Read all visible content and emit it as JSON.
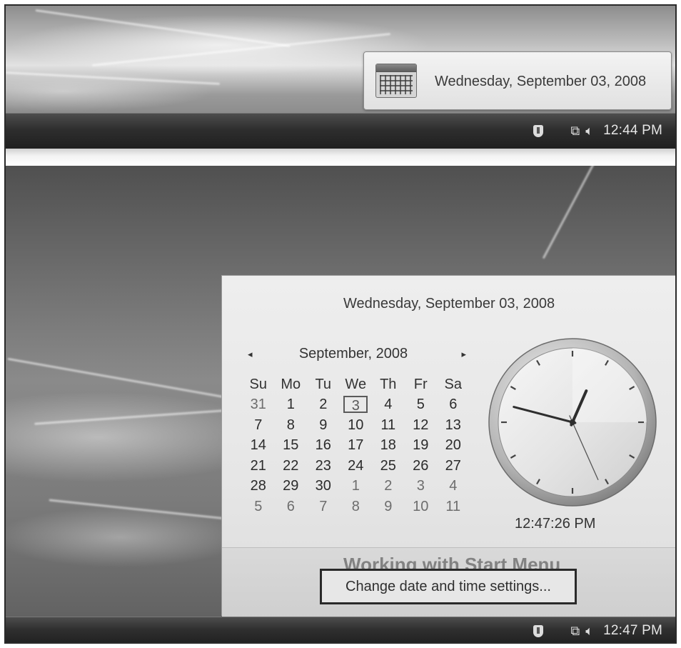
{
  "tooltip": {
    "icon": "calendar-icon",
    "date_text": "Wednesday, September 03, 2008"
  },
  "taskbar_top": {
    "tray_icons": [
      "shield-icon",
      "network-icon",
      "volume-icon"
    ],
    "time": "12:44 PM"
  },
  "flyout": {
    "long_date": "Wednesday, September 03, 2008",
    "month_label": "September, 2008",
    "nav_prev": "◂",
    "nav_next": "▸",
    "weekdays": [
      "Su",
      "Mo",
      "Tu",
      "We",
      "Th",
      "Fr",
      "Sa"
    ],
    "weeks": [
      [
        "31",
        "1",
        "2",
        "3",
        "4",
        "5",
        "6"
      ],
      [
        "7",
        "8",
        "9",
        "10",
        "11",
        "12",
        "13"
      ],
      [
        "14",
        "15",
        "16",
        "17",
        "18",
        "19",
        "20"
      ],
      [
        "21",
        "22",
        "23",
        "24",
        "25",
        "26",
        "27"
      ],
      [
        "28",
        "29",
        "30",
        "1",
        "2",
        "3",
        "4"
      ],
      [
        "5",
        "6",
        "7",
        "8",
        "9",
        "10",
        "11"
      ]
    ],
    "today": "3",
    "clock_time": {
      "hour": 12,
      "minute": 47,
      "second": 26
    },
    "digital_time": "12:47:26 PM",
    "change_link": "Change date and time settings...",
    "background_heading": "Working with Start Menu"
  },
  "taskbar_bottom": {
    "tray_icons": [
      "shield-icon",
      "network-icon",
      "volume-icon"
    ],
    "time": "12:47 PM"
  }
}
